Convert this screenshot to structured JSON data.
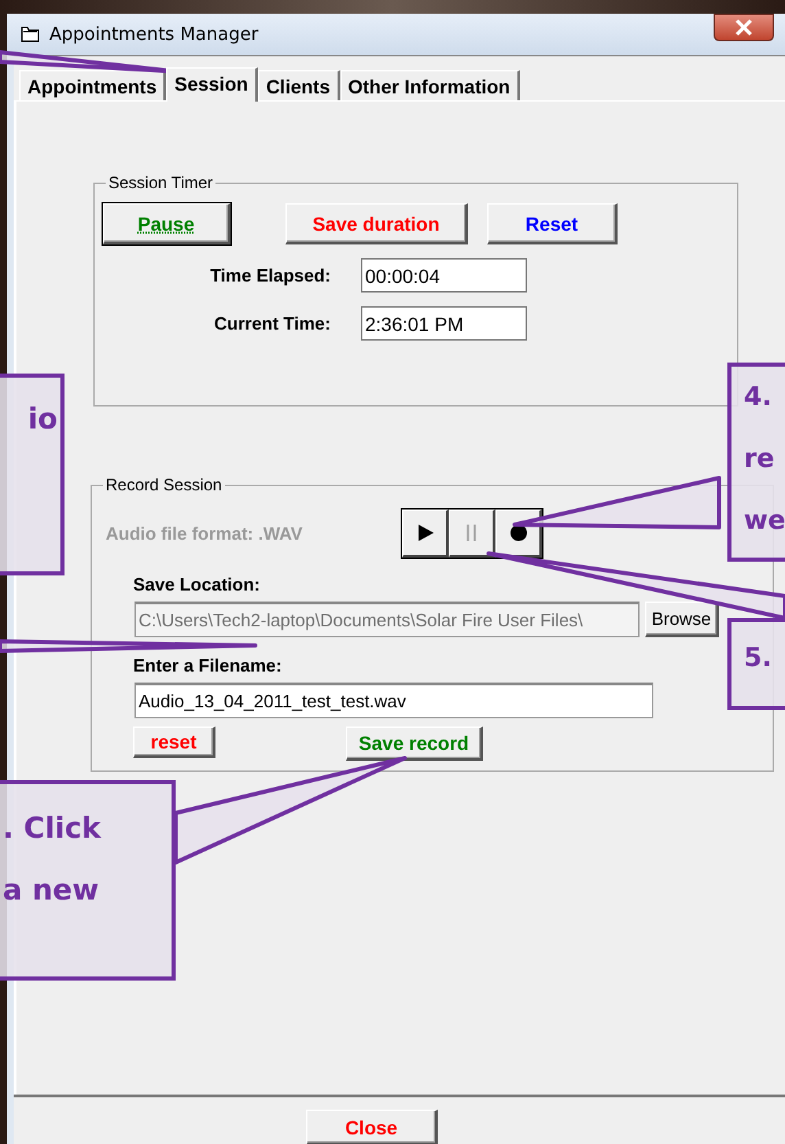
{
  "window": {
    "title": "Appointments Manager"
  },
  "tabs": [
    {
      "label": "Appointments",
      "selected": false
    },
    {
      "label": "Session",
      "selected": true
    },
    {
      "label": "Clients",
      "selected": false
    },
    {
      "label": "Other Information",
      "selected": false
    }
  ],
  "session_timer": {
    "title": "Session Timer",
    "buttons": [
      {
        "label": "Pause",
        "color": "#008000",
        "focused": true
      },
      {
        "label": "Save duration",
        "color": "#ff0000",
        "focused": false
      },
      {
        "label": "Reset",
        "color": "#0000ff",
        "focused": false
      }
    ],
    "fields": [
      {
        "label": "Time Elapsed:",
        "value": "00:00:04"
      },
      {
        "label": "Current Time:",
        "value": "2:36:01 PM"
      }
    ]
  },
  "record_session": {
    "title": "Record Session",
    "format_label": "Audio file format: .WAV",
    "player_buttons": [
      {
        "kind": "play",
        "disabled": false
      },
      {
        "kind": "pause",
        "disabled": true
      },
      {
        "kind": "record",
        "disabled": false
      }
    ],
    "save_location": {
      "label": "Save Location:",
      "value": "C:\\Users\\Tech2-laptop\\Documents\\Solar Fire User Files\\",
      "disabled": true
    },
    "browse_button": "Browse",
    "filename": {
      "label": "Enter a Filename:",
      "value": "Audio_13_04_2011_test_test.wav"
    },
    "buttons": [
      {
        "label": "reset",
        "color": "#ff0000"
      },
      {
        "label": "Save record",
        "color": "#008000"
      }
    ]
  },
  "close_button": {
    "label": "Close",
    "color": "#ff0000"
  },
  "callouts": [
    {
      "lines": [
        "io"
      ]
    },
    {
      "lines": [
        "4.",
        "re",
        "we"
      ]
    },
    {
      "lines": [
        "5."
      ]
    },
    {
      "lines": [
        ". Click",
        "a new"
      ]
    }
  ]
}
